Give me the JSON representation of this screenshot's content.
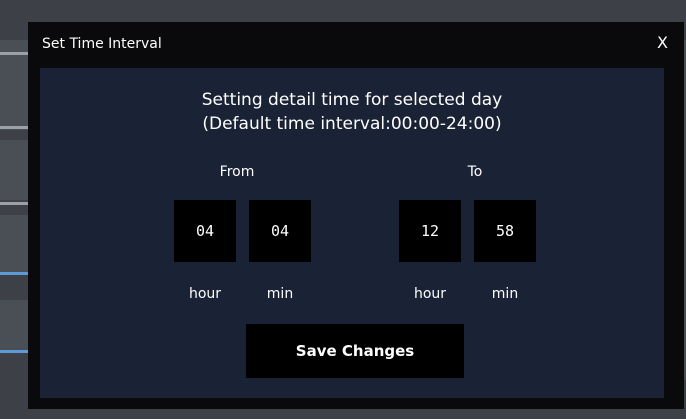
{
  "dialog": {
    "title": "Set Time Interval",
    "close_label": "X",
    "heading_line1": "Setting detail time for selected day",
    "heading_line2": "(Default time interval:00:00-24:00)",
    "from_label": "From",
    "to_label": "To",
    "from": {
      "hour": "04",
      "min": "04"
    },
    "to": {
      "hour": "12",
      "min": "58"
    },
    "hour_label": "hour",
    "min_label": "min",
    "save_label": "Save Changes"
  },
  "colors": {
    "dialog_bg": "#0a0a0c",
    "content_bg": "#1a2235",
    "box_bg": "#000000",
    "text": "#ffffff"
  }
}
